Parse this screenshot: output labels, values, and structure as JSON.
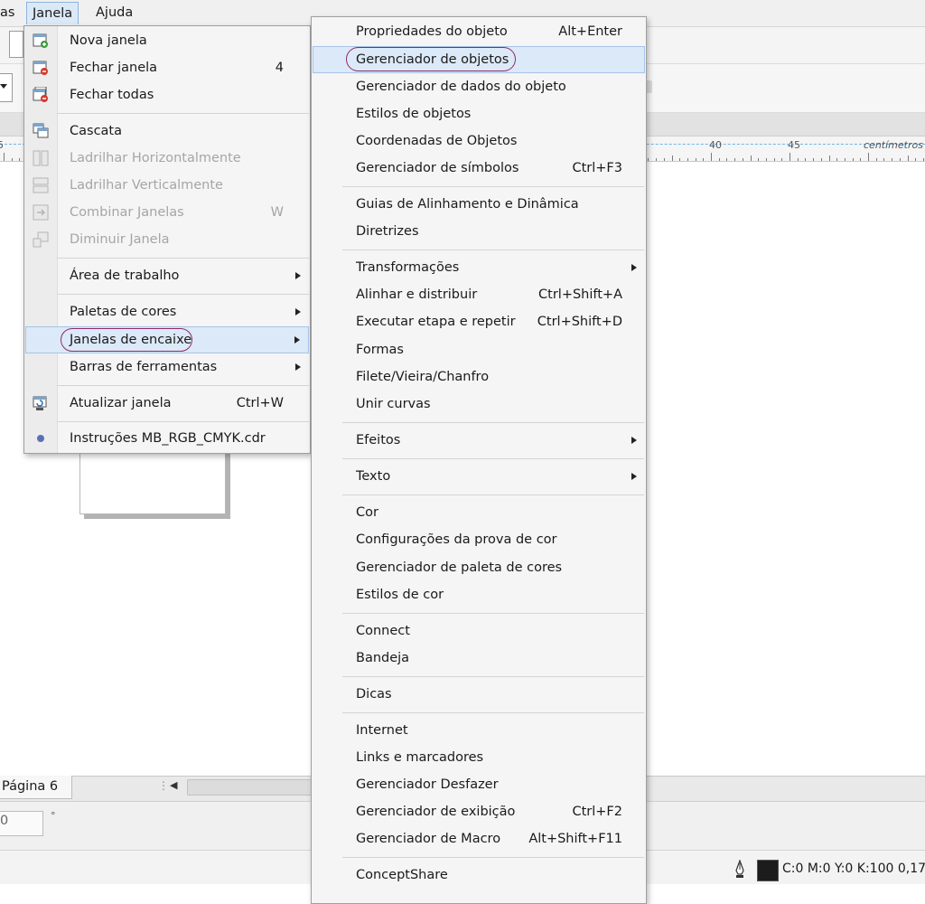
{
  "menubar": {
    "items": [
      {
        "label": "as"
      },
      {
        "label": "Janela"
      },
      {
        "label": "Ajuda"
      }
    ]
  },
  "ruler": {
    "labels": [
      "5",
      "40",
      "45"
    ],
    "unit": "centímetros"
  },
  "janela_menu": {
    "items": [
      {
        "label": "Nova janela",
        "shortcut": ""
      },
      {
        "label": "Fechar janela",
        "shortcut": "4"
      },
      {
        "label": "Fechar todas",
        "shortcut": ""
      },
      {
        "label": "Cascata",
        "shortcut": ""
      },
      {
        "label": "Ladrilhar Horizontalmente",
        "shortcut": ""
      },
      {
        "label": "Ladrilhar Verticalmente",
        "shortcut": ""
      },
      {
        "label": "Combinar Janelas",
        "shortcut": "W"
      },
      {
        "label": "Diminuir Janela",
        "shortcut": ""
      },
      {
        "label": "Área de trabalho",
        "shortcut": ""
      },
      {
        "label": "Paletas de cores",
        "shortcut": ""
      },
      {
        "label": "Janelas de encaixe",
        "shortcut": ""
      },
      {
        "label": "Barras de ferramentas",
        "shortcut": ""
      },
      {
        "label": "Atualizar janela",
        "shortcut": "Ctrl+W"
      },
      {
        "label": "Instruções MB_RGB_CMYK.cdr",
        "shortcut": ""
      }
    ]
  },
  "encaixe_menu": {
    "items": [
      {
        "label": "Propriedades do objeto",
        "shortcut": "Alt+Enter"
      },
      {
        "label": "Gerenciador de objetos",
        "shortcut": ""
      },
      {
        "label": "Gerenciador de dados do objeto",
        "shortcut": ""
      },
      {
        "label": "Estilos de objetos",
        "shortcut": ""
      },
      {
        "label": "Coordenadas de Objetos",
        "shortcut": ""
      },
      {
        "label": "Gerenciador de símbolos",
        "shortcut": "Ctrl+F3"
      },
      {
        "label": "Guias de Alinhamento e Dinâmica",
        "shortcut": ""
      },
      {
        "label": "Diretrizes",
        "shortcut": ""
      },
      {
        "label": "Transformações",
        "shortcut": ""
      },
      {
        "label": "Alinhar e distribuir",
        "shortcut": "Ctrl+Shift+A"
      },
      {
        "label": "Executar etapa e repetir",
        "shortcut": "Ctrl+Shift+D"
      },
      {
        "label": "Formas",
        "shortcut": ""
      },
      {
        "label": "Filete/Vieira/Chanfro",
        "shortcut": ""
      },
      {
        "label": "Unir curvas",
        "shortcut": ""
      },
      {
        "label": "Efeitos",
        "shortcut": ""
      },
      {
        "label": "Texto",
        "shortcut": ""
      },
      {
        "label": "Cor",
        "shortcut": ""
      },
      {
        "label": "Configurações da prova de cor",
        "shortcut": ""
      },
      {
        "label": "Gerenciador de paleta de cores",
        "shortcut": ""
      },
      {
        "label": "Estilos de cor",
        "shortcut": ""
      },
      {
        "label": "Connect",
        "shortcut": ""
      },
      {
        "label": "Bandeja",
        "shortcut": ""
      },
      {
        "label": "Dicas",
        "shortcut": ""
      },
      {
        "label": "Internet",
        "shortcut": ""
      },
      {
        "label": "Links e marcadores",
        "shortcut": ""
      },
      {
        "label": "Gerenciador Desfazer",
        "shortcut": ""
      },
      {
        "label": "Gerenciador de exibição",
        "shortcut": "Ctrl+F2"
      },
      {
        "label": "Gerenciador de Macro",
        "shortcut": "Alt+Shift+F11"
      },
      {
        "label": "ConceptShare",
        "shortcut": ""
      }
    ]
  },
  "pagebar": {
    "page_tab": "Página 6"
  },
  "status": {
    "input_value": "0",
    "degree": "°",
    "color_readout": "C:0 M:0 Y:0 K:100  0,17"
  },
  "colors": {
    "highlight_bg": "#dce9f8",
    "annotation_circle": "#8a2b63",
    "fill_swatch": "#1c1c1c"
  }
}
